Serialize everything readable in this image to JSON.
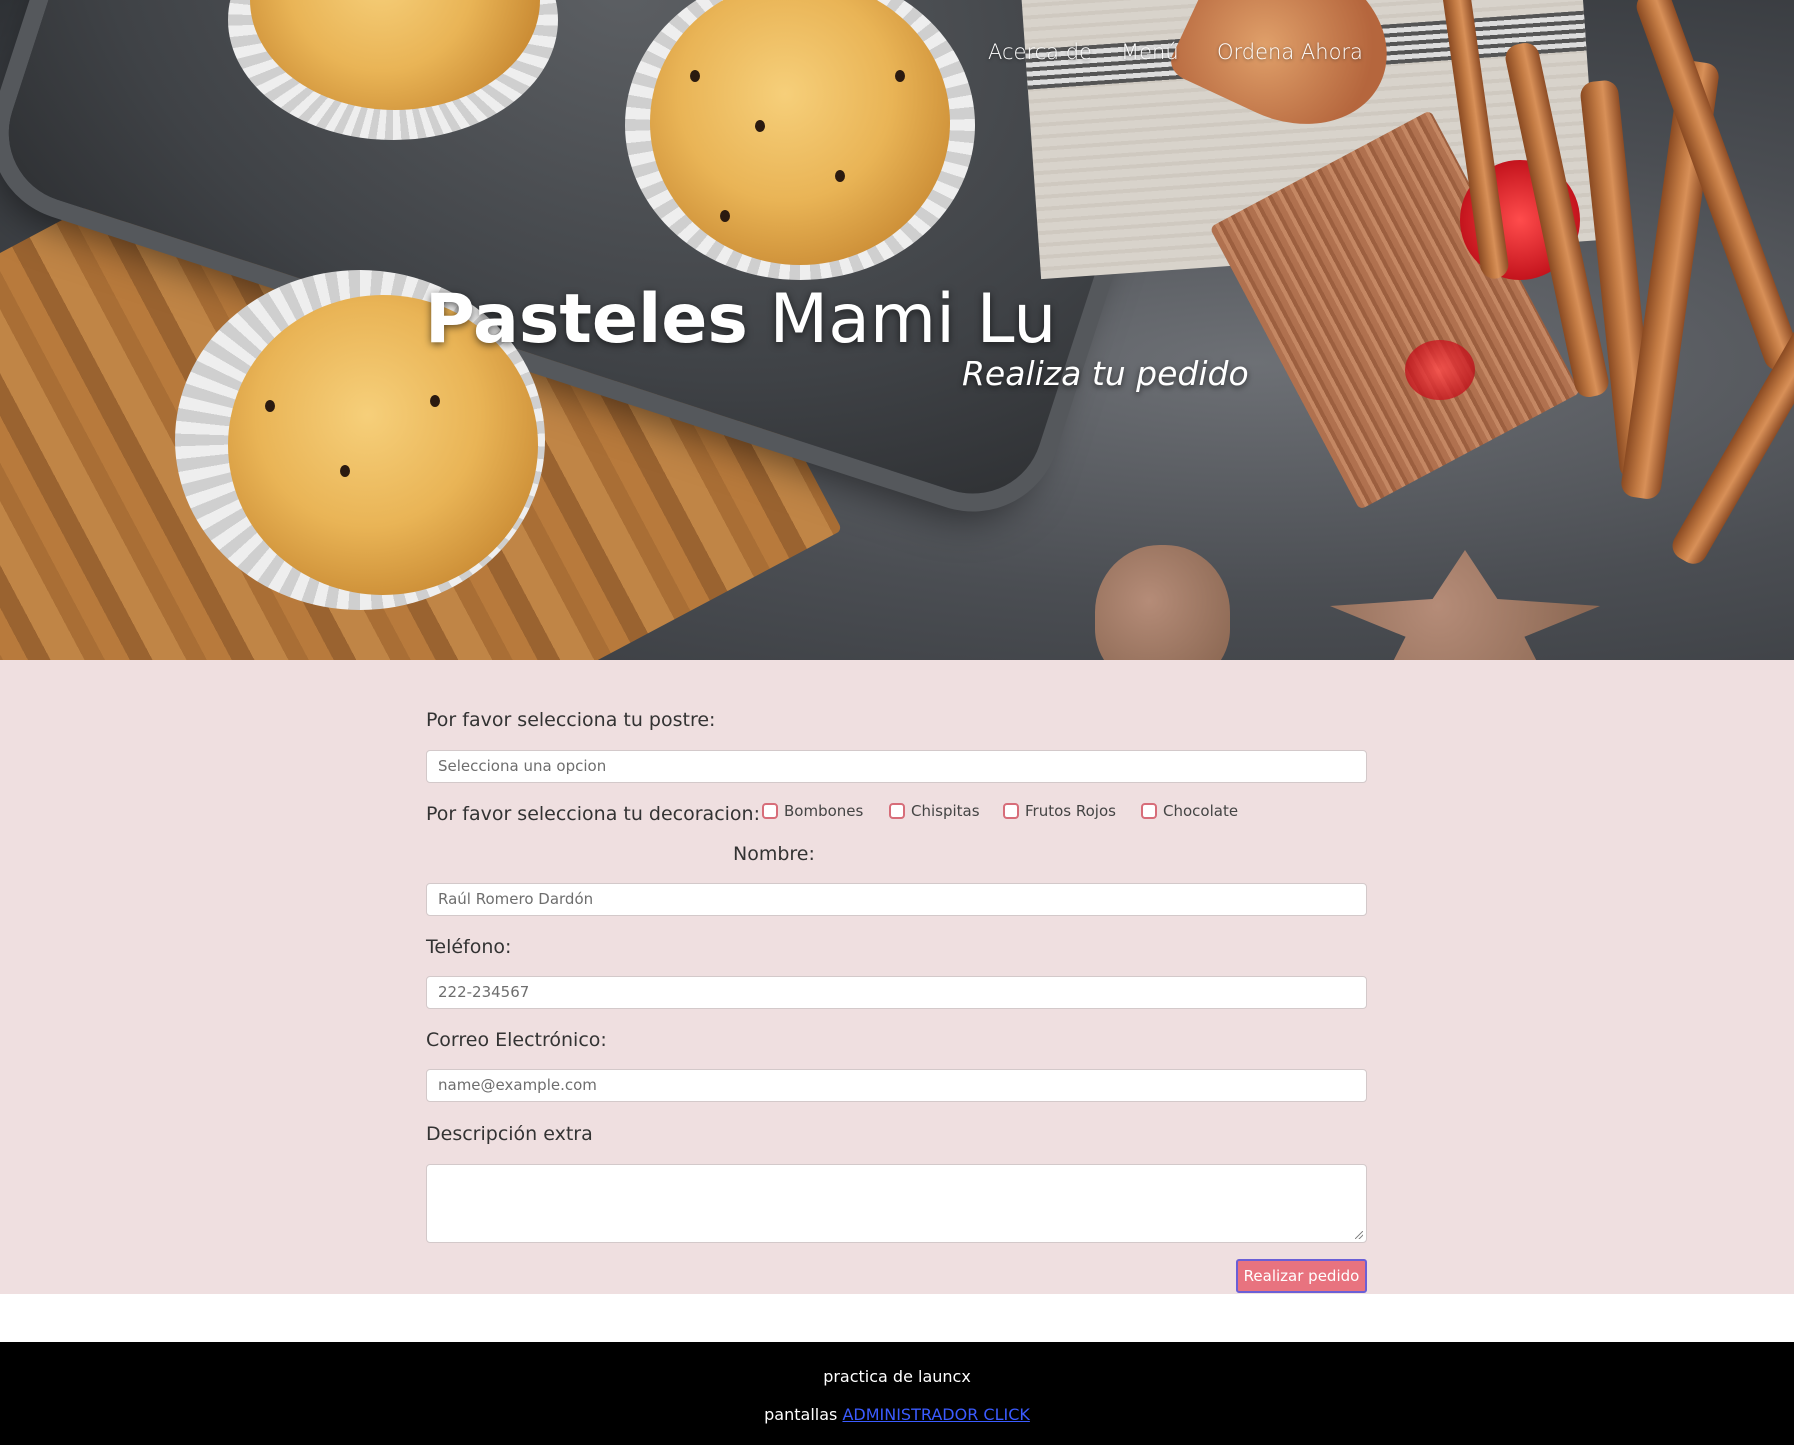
{
  "nav": {
    "items": [
      "Acerca de",
      "Menú",
      "Ordena Ahora"
    ]
  },
  "hero": {
    "title_bold": "Pasteles",
    "title_light": "Mami Lu",
    "subtitle": "Realiza tu pedido"
  },
  "form": {
    "postre_label": "Por favor selecciona tu postre:",
    "postre_select": "Selecciona una opcion",
    "decoracion_label": "Por favor selecciona tu decoracion:",
    "decoraciones": [
      "Bombones",
      "Chispitas",
      "Frutos Rojos",
      "Chocolate"
    ],
    "nombre_label": "Nombre:",
    "nombre_placeholder": "Raúl Romero Dardón",
    "telefono_label": "Teléfono:",
    "telefono_placeholder": "222-234567",
    "correo_label": "Correo Electrónico:",
    "correo_placeholder": "name@example.com",
    "descripcion_label": "Descripción extra",
    "submit_label": "Realizar pedido"
  },
  "footer": {
    "line1": "practica de launcx",
    "line2_prefix": "pantallas",
    "line2_link": "ADMINISTRADOR CLICK"
  },
  "colors": {
    "form_background": "#efdfe0",
    "button": "#e8737f",
    "checkbox_border": "#d76d79",
    "footer_background": "#000000",
    "link": "#3b5bff"
  }
}
